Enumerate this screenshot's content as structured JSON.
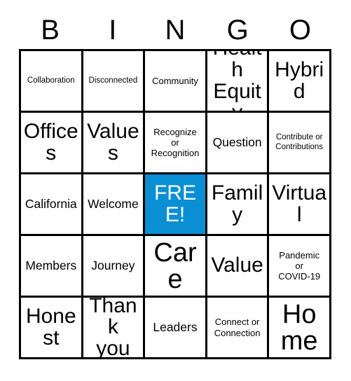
{
  "card": {
    "header": {
      "letters": [
        "B",
        "I",
        "N",
        "G",
        "O"
      ]
    },
    "free_space": {
      "label": "FREE!",
      "background_color": "#0a8fd4",
      "text_color": "#ffffff"
    },
    "grid_line_color": "#000000",
    "cell_background": "#ffffff",
    "cells": [
      {
        "label": "Collaboration",
        "size": "xs",
        "free": false
      },
      {
        "label": "Disconnected",
        "size": "xs",
        "free": false
      },
      {
        "label": "Community",
        "size": "sm",
        "free": false
      },
      {
        "label": "Health\nEquity",
        "size": "xl",
        "free": false
      },
      {
        "label": "Hybrid",
        "size": "xl",
        "free": false
      },
      {
        "label": "Offices",
        "size": "xl",
        "free": false
      },
      {
        "label": "Values",
        "size": "xl",
        "free": false
      },
      {
        "label": "Recognize\nor\nRecognition",
        "size": "sm",
        "free": false
      },
      {
        "label": "Question",
        "size": "md",
        "free": false
      },
      {
        "label": "Contribute or\nContributions",
        "size": "xs",
        "free": false
      },
      {
        "label": "California",
        "size": "md",
        "free": false
      },
      {
        "label": "Welcome",
        "size": "md",
        "free": false
      },
      {
        "label": "FREE!",
        "size": "xl",
        "free": true
      },
      {
        "label": "Family",
        "size": "xl",
        "free": false
      },
      {
        "label": "Virtual",
        "size": "xl",
        "free": false
      },
      {
        "label": "Members",
        "size": "md",
        "free": false
      },
      {
        "label": "Journey",
        "size": "md",
        "free": false
      },
      {
        "label": "Care",
        "size": "xxl",
        "free": false
      },
      {
        "label": "Value",
        "size": "xl",
        "free": false
      },
      {
        "label": "Pandemic\nor\nCOVID-19",
        "size": "sm",
        "free": false
      },
      {
        "label": "Honest",
        "size": "xl",
        "free": false
      },
      {
        "label": "Thank\nyou",
        "size": "xl",
        "free": false
      },
      {
        "label": "Leaders",
        "size": "md",
        "free": false
      },
      {
        "label": "Connect or\nConnection",
        "size": "sm",
        "free": false
      },
      {
        "label": "Home",
        "size": "xxl",
        "free": false
      }
    ]
  }
}
